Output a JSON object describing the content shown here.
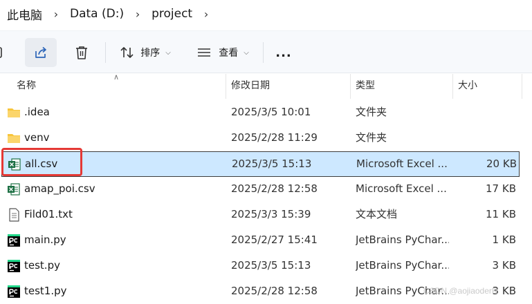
{
  "breadcrumb": [
    "此电脑",
    "Data (D:)",
    "project"
  ],
  "toolbar": {
    "sort_label": "排序",
    "view_label": "查看",
    "more_label": "..."
  },
  "columns": {
    "name": "名称",
    "date": "修改日期",
    "type": "类型",
    "size": "大小"
  },
  "files": [
    {
      "name": ".idea",
      "date": "2025/3/5 10:01",
      "type": "文件夹",
      "size": "",
      "icon": "folder-icon"
    },
    {
      "name": "venv",
      "date": "2025/2/28 11:29",
      "type": "文件夹",
      "size": "",
      "icon": "folder-icon"
    },
    {
      "name": "all.csv",
      "date": "2025/3/5 15:13",
      "type": "Microsoft Excel ...",
      "size": "20 KB",
      "icon": "excel-csv-icon",
      "selected": true
    },
    {
      "name": "amap_poi.csv",
      "date": "2025/2/28 12:58",
      "type": "Microsoft Excel ...",
      "size": "17 KB",
      "icon": "excel-csv-icon"
    },
    {
      "name": "Fild01.txt",
      "date": "2025/3/3 15:39",
      "type": "文本文档",
      "size": "11 KB",
      "icon": "text-file-icon"
    },
    {
      "name": "main.py",
      "date": "2025/2/27 15:41",
      "type": "JetBrains PyChar...",
      "size": "1 KB",
      "icon": "pycharm-file-icon"
    },
    {
      "name": "test.py",
      "date": "2025/3/5 15:13",
      "type": "JetBrains PyChar...",
      "size": "3 KB",
      "icon": "pycharm-file-icon"
    },
    {
      "name": "test1.py",
      "date": "2025/2/28 12:58",
      "type": "JetBrains PyChar...",
      "size": "3 KB",
      "icon": "pycharm-file-icon"
    }
  ],
  "watermark": "CSDN @aojiaoderR",
  "colors": {
    "selection": "#cde8ff",
    "highlight_box": "#e53935",
    "folder": "#f8c53a",
    "excel": "#1d7044"
  }
}
